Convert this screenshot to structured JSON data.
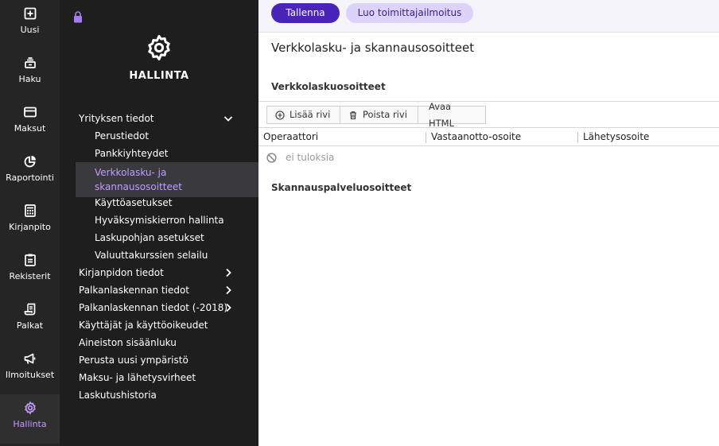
{
  "rail": {
    "items": [
      {
        "label": "Uusi",
        "icon": "plus-square-icon"
      },
      {
        "label": "Haku",
        "icon": "search-stack-icon"
      },
      {
        "label": "Maksut",
        "icon": "card-icon"
      },
      {
        "label": "Raportointi",
        "icon": "pie-chart-icon"
      },
      {
        "label": "Kirjanpito",
        "icon": "calculator-icon"
      },
      {
        "label": "Rekisterit",
        "icon": "clipboard-icon"
      },
      {
        "label": "Palkat",
        "icon": "scroll-icon"
      },
      {
        "label": "Ilmoitukset",
        "icon": "megaphone-icon"
      },
      {
        "label": "Hallinta",
        "icon": "gear-icon"
      }
    ],
    "active": "Hallinta",
    "active_color": "#c39bff"
  },
  "submenu": {
    "title": "HALLINTA",
    "groups": [
      {
        "label": "Yrityksen tiedot",
        "expanded": true
      },
      {
        "label": "Kirjanpidon tiedot"
      },
      {
        "label": "Palkanlaskennan tiedot"
      },
      {
        "label": "Palkanlaskennan tiedot (-2018)"
      },
      {
        "label": "Käyttäjät ja käyttöoikeudet"
      },
      {
        "label": "Aineiston sisäänluku"
      },
      {
        "label": "Perusta uusi ympäristö"
      },
      {
        "label": "Maksu- ja lähetysvirheet"
      },
      {
        "label": "Laskutushistoria"
      }
    ],
    "children": [
      {
        "label": "Perustiedot"
      },
      {
        "label": "Pankkiyhteydet"
      },
      {
        "label": "Verkkolasku- ja skannausosoitteet",
        "active": true
      },
      {
        "label": "Käyttöasetukset"
      },
      {
        "label": "Hyväksymiskierron hallinta"
      },
      {
        "label": "Laskupohjan asetukset"
      },
      {
        "label": "Valuuttakurssien selailu"
      }
    ]
  },
  "toolbar": {
    "save_label": "Tallenna",
    "create_supplier_label": "Luo toimittajailmoitus",
    "primary_color": "#4a23b8",
    "secondary_color": "#ddd2f8"
  },
  "main": {
    "page_title": "Verkkolasku- ja skannausosoitteet",
    "einvoice_section": "Verkkolaskuosoitteet",
    "scan_section": "Skannauspalveluosoitteet",
    "grid_buttons": {
      "add_row": "Lisää rivi",
      "delete_row": "Poista rivi",
      "open_html": "Avaa HTML"
    },
    "columns": [
      "Operaattori",
      "Vastaanotto-osoite",
      "Lähetysosoite"
    ],
    "empty_text": "ei tuloksia"
  }
}
